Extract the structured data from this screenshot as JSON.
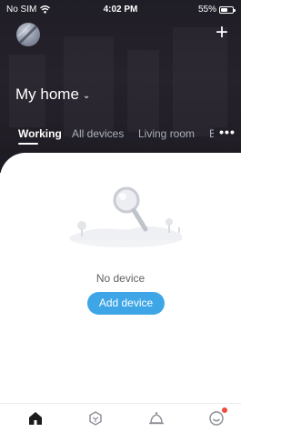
{
  "status_bar": {
    "carrier": "No SIM",
    "time": "4:02 PM",
    "battery_text": "55%",
    "battery_level": 0.55
  },
  "header": {
    "home_name": "My home",
    "add_icon": "plus-icon",
    "avatar_icon": "user-avatar"
  },
  "tabs": [
    {
      "label": "Working",
      "active": true
    },
    {
      "label": "All devices",
      "active": false
    },
    {
      "label": "Living room",
      "active": false
    },
    {
      "label": "B",
      "active": false
    }
  ],
  "more_label": "•••",
  "empty_state": {
    "message": "No device",
    "button_label": "Add device",
    "illustration_icon": "magnifier-illustration"
  },
  "tab_bar": {
    "items": [
      {
        "name": "home",
        "icon": "home-icon",
        "active": true
      },
      {
        "name": "smart",
        "icon": "cube-icon",
        "active": false
      },
      {
        "name": "scene",
        "icon": "bell-icon",
        "active": false
      },
      {
        "name": "me",
        "icon": "smiley-icon",
        "active": false,
        "badge": true
      }
    ]
  },
  "colors": {
    "header_bg": "#1f1d26",
    "accent": "#3ea6e6",
    "badge": "#f04a3e",
    "tab_inactive": "#aab0bb"
  }
}
